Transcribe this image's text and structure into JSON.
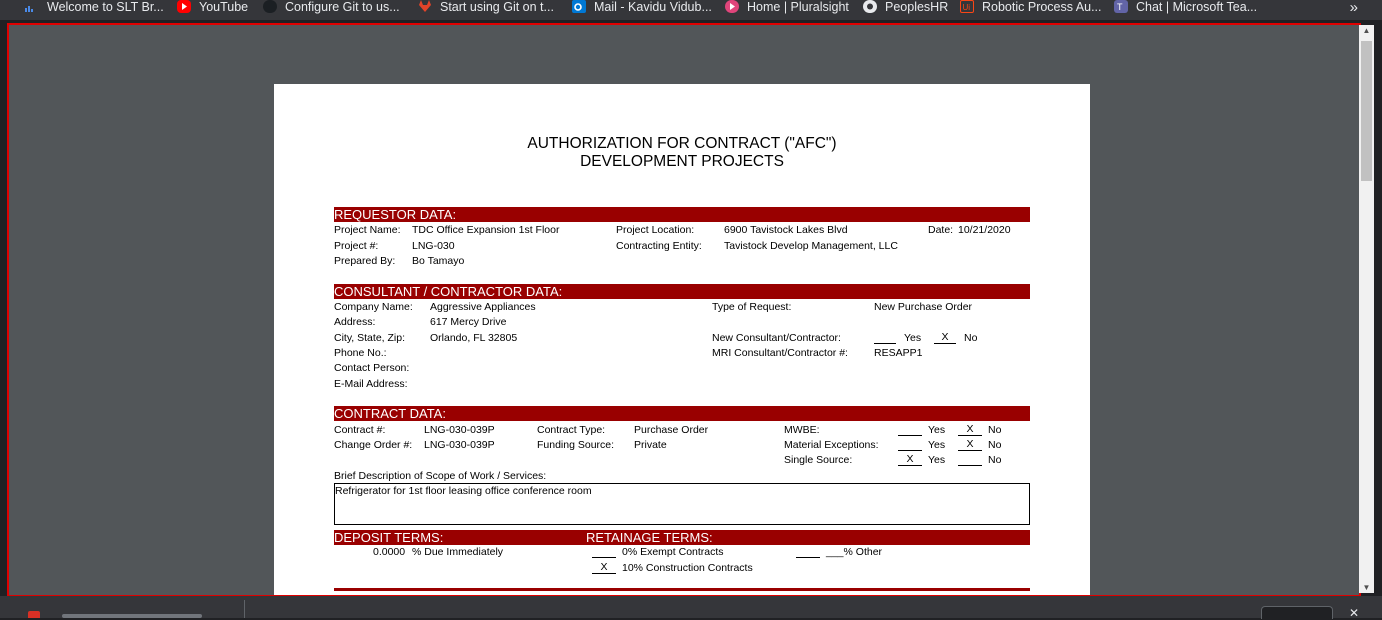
{
  "bookmarks": [
    {
      "label": "Welcome to SLT Br...",
      "icon": "slt-icon",
      "color": "#2d6ac7"
    },
    {
      "label": "YouTube",
      "icon": "youtube-icon",
      "color": "#ff0000"
    },
    {
      "label": "Configure Git to us...",
      "icon": "github-icon",
      "color": "#24292e"
    },
    {
      "label": "Start using Git on t...",
      "icon": "gitlab-icon",
      "color": "#e24329"
    },
    {
      "label": "Mail - Kavidu Vidub...",
      "icon": "outlook-icon",
      "color": "#0078d4"
    },
    {
      "label": "Home | Pluralsight",
      "icon": "pluralsight-icon",
      "color": "#f15b2a"
    },
    {
      "label": "PeoplesHR",
      "icon": "peopleshr-icon",
      "color": "#ffffff"
    },
    {
      "label": "Robotic Process Au...",
      "icon": "uipath-icon",
      "color": "#fa4616"
    },
    {
      "label": "Chat | Microsoft Tea...",
      "icon": "teams-icon",
      "color": "#6264a7"
    }
  ],
  "overflow_icon": "chevron-double-right-icon",
  "document": {
    "title_line1": "AUTHORIZATION FOR CONTRACT (\"AFC\")",
    "title_line2": "DEVELOPMENT PROJECTS",
    "accent_color": "#990000",
    "requestor": {
      "header": "REQUESTOR DATA:",
      "project_name_label": "Project Name:",
      "project_name": "TDC Office Expansion 1st Floor",
      "project_location_label": "Project Location:",
      "project_location": "6900 Tavistock Lakes Blvd",
      "date_label": "Date:",
      "date": "10/21/2020",
      "project_no_label": "Project #:",
      "project_no": "LNG-030",
      "contracting_entity_label": "Contracting Entity:",
      "contracting_entity": "Tavistock Develop Management, LLC",
      "prepared_by_label": "Prepared By:",
      "prepared_by": "Bo Tamayo"
    },
    "consultant": {
      "header": "CONSULTANT / CONTRACTOR DATA:",
      "company_name_label": "Company Name:",
      "company_name": "Aggressive Appliances",
      "address_label": "Address:",
      "address": "617 Mercy Drive",
      "city_label": "City, State, Zip:",
      "city": "Orlando, FL  32805",
      "phone_label": "Phone No.:",
      "contact_label": "Contact Person:",
      "email_label": "E-Mail Address:",
      "type_of_request_label": "Type of Request:",
      "type_of_request": "New Purchase Order",
      "new_consultant_label": "New Consultant/Contractor:",
      "new_consultant_yes_mark": "",
      "new_consultant_no_mark": "X",
      "mri_label": "MRI Consultant/Contractor #:",
      "mri": "RESAPP1",
      "yes": "Yes",
      "no": "No"
    },
    "contract": {
      "header": "CONTRACT DATA:",
      "contract_no_label": "Contract #:",
      "contract_no": "LNG-030-039P",
      "change_order_label": "Change Order #:",
      "change_order": "LNG-030-039P",
      "contract_type_label": "Contract Type:",
      "contract_type": "Purchase Order",
      "funding_source_label": "Funding Source:",
      "funding_source": "Private",
      "mwbe_label": "MWBE:",
      "mwbe_yes_mark": "",
      "mwbe_no_mark": "X",
      "material_label": "Material Exceptions:",
      "material_yes_mark": "",
      "material_no_mark": "X",
      "single_source_label": "Single Source:",
      "single_source_yes_mark": "X",
      "single_source_no_mark": "",
      "yes": "Yes",
      "no": "No",
      "brief_label": "Brief Description of Scope of Work / Services:",
      "brief": "Refrigerator for 1st floor leasing office  conference room"
    },
    "deposit": {
      "header": "DEPOSIT TERMS:",
      "percent": "0.0000",
      "percent_text": "% Due Immediately"
    },
    "retainage": {
      "header": "RETAINAGE TERMS:",
      "exempt_mark": "",
      "exempt_text": "0% Exempt Contracts",
      "construction_mark": "X",
      "construction_text": "10% Construction Contracts",
      "other_mark": "",
      "other_text": "___% Other"
    }
  },
  "downloads": {
    "file_icon": "pdf-file-icon",
    "close_icon": "close-icon"
  }
}
